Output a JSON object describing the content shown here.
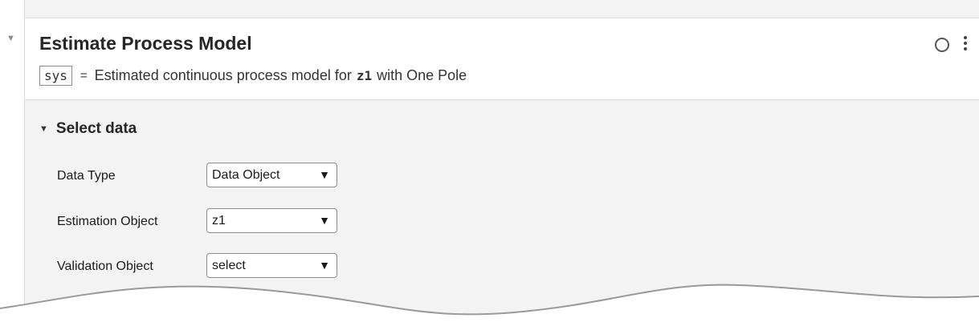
{
  "task": {
    "title": "Estimate Process Model",
    "output_variable": "sys",
    "summary_equals": "=",
    "summary_prefix": "Estimated continuous process model for",
    "summary_data": "z1",
    "summary_suffix": "with One Pole"
  },
  "icons": {
    "collapse": "caret-down-icon",
    "status": "circle-status-icon",
    "more": "vertical-ellipsis-icon"
  },
  "section": {
    "title": "Select data",
    "rows": [
      {
        "label": "Data Type",
        "value": "Data Object"
      },
      {
        "label": "Estimation Object",
        "value": "z1"
      },
      {
        "label": "Validation Object",
        "value": "select"
      }
    ]
  },
  "colors": {
    "card_background": "#f3f3f3",
    "header_background": "#ffffff",
    "border": "#8d8d8d"
  }
}
